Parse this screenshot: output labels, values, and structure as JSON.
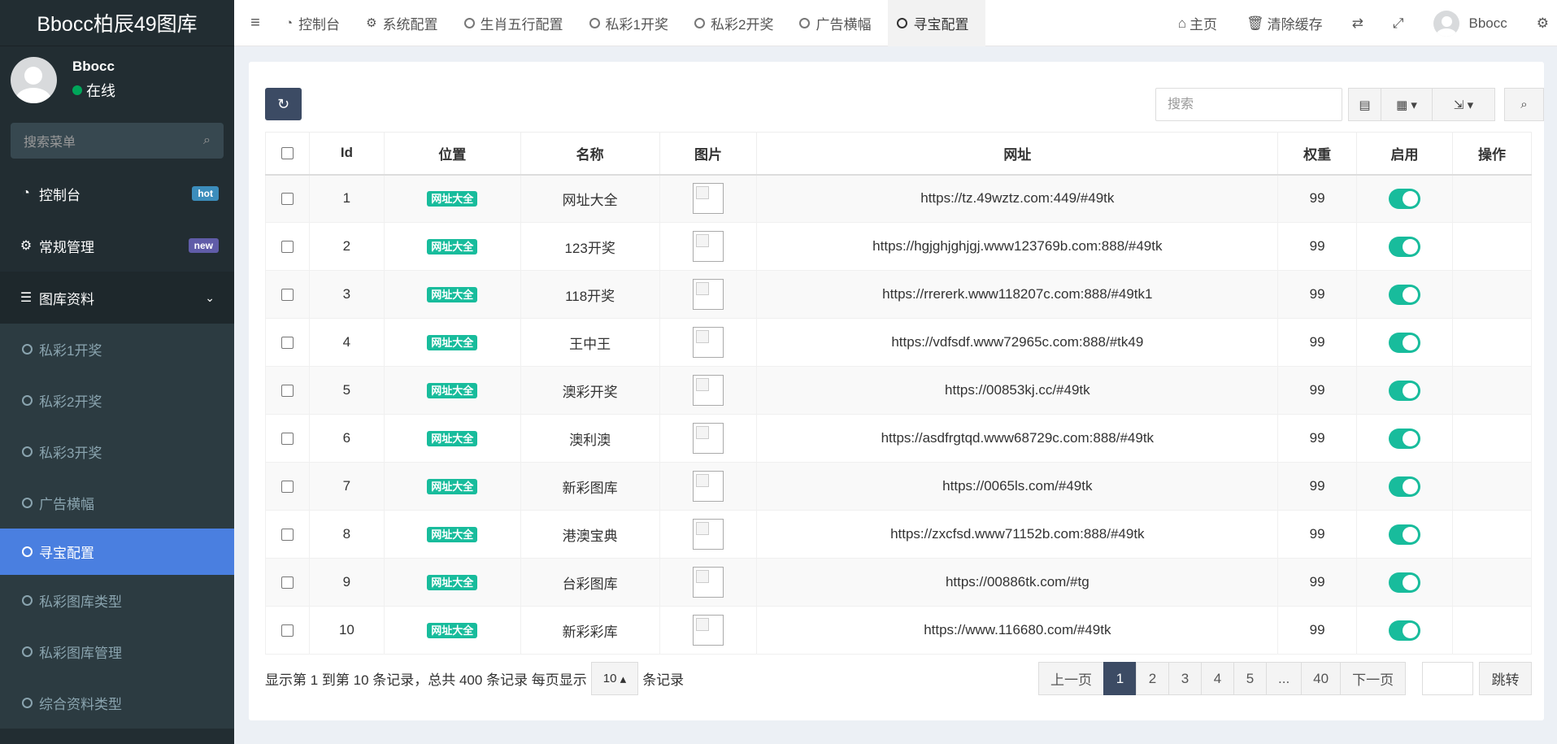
{
  "app": {
    "brand": "Bbocc柏辰49图库"
  },
  "user": {
    "name": "Bbocc",
    "status": "在线"
  },
  "sidebar": {
    "search_placeholder": "搜索菜单",
    "items": [
      {
        "label": "控制台",
        "icon": "dashboard-icon",
        "badge": "hot",
        "badge_color": "#3c8dbc"
      },
      {
        "label": "常规管理",
        "icon": "cogs-icon",
        "badge": "new",
        "badge_color": "#605ca8"
      },
      {
        "label": "图库资料",
        "icon": "list-icon"
      }
    ],
    "sub_items": [
      "私彩1开奖",
      "私彩2开奖",
      "私彩3开奖",
      "广告横幅",
      "寻宝配置",
      "私彩图库类型",
      "私彩图库管理",
      "综合资料类型"
    ],
    "active_sub": "寻宝配置"
  },
  "topbar": {
    "tabs": [
      {
        "label": "控制台",
        "icon": "dashboard-icon"
      },
      {
        "label": "系统配置",
        "icon": "gear-icon"
      },
      {
        "label": "生肖五行配置",
        "icon": "circle-icon"
      },
      {
        "label": "私彩1开奖",
        "icon": "circle-icon"
      },
      {
        "label": "私彩2开奖",
        "icon": "circle-icon"
      },
      {
        "label": "广告横幅",
        "icon": "circle-icon"
      },
      {
        "label": "寻宝配置",
        "icon": "circle-icon",
        "active": true
      }
    ],
    "home_label": "主页",
    "clear_cache_label": "清除缓存",
    "user_name": "Bbocc"
  },
  "toolbar": {
    "search_placeholder": "搜索"
  },
  "table": {
    "columns": [
      "Id",
      "位置",
      "名称",
      "图片",
      "网址",
      "权重",
      "启用",
      "操作"
    ],
    "rows": [
      {
        "id": "1",
        "position": "网址大全",
        "name": "网址大全",
        "url": "https://tz.49wztz.com:449/#49tk",
        "weight": "99",
        "enabled": true
      },
      {
        "id": "2",
        "position": "网址大全",
        "name": "123开奖",
        "url": "https://hgjghjghjgj.www123769b.com:888/#49tk",
        "weight": "99",
        "enabled": true
      },
      {
        "id": "3",
        "position": "网址大全",
        "name": "118开奖",
        "url": "https://rrererk.www118207c.com:888/#49tk1",
        "weight": "99",
        "enabled": true
      },
      {
        "id": "4",
        "position": "网址大全",
        "name": "王中王",
        "url": "https://vdfsdf.www72965c.com:888/#tk49",
        "weight": "99",
        "enabled": true
      },
      {
        "id": "5",
        "position": "网址大全",
        "name": "澳彩开奖",
        "url": "https://00853kj.cc/#49tk",
        "weight": "99",
        "enabled": true
      },
      {
        "id": "6",
        "position": "网址大全",
        "name": "澳利澳",
        "url": "https://asdfrgtqd.www68729c.com:888/#49tk",
        "weight": "99",
        "enabled": true
      },
      {
        "id": "7",
        "position": "网址大全",
        "name": "新彩图库",
        "url": "https://0065ls.com/#49tk",
        "weight": "99",
        "enabled": true
      },
      {
        "id": "8",
        "position": "网址大全",
        "name": "港澳宝典",
        "url": "https://zxcfsd.www71152b.com:888/#49tk",
        "weight": "99",
        "enabled": true
      },
      {
        "id": "9",
        "position": "网址大全",
        "name": "台彩图库",
        "url": "https://00886tk.com/#tg",
        "weight": "99",
        "enabled": true
      },
      {
        "id": "10",
        "position": "网址大全",
        "name": "新彩彩库",
        "url": "https://www.116680.com/#49tk",
        "weight": "99",
        "enabled": true
      }
    ]
  },
  "footer": {
    "info_prefix": "显示第 1 到第 10 条记录，总共 400 条记录 每页显示",
    "page_size": "10",
    "info_suffix": "条记录",
    "prev_label": "上一页",
    "next_label": "下一页",
    "pages": [
      "1",
      "2",
      "3",
      "4",
      "5",
      "...",
      "40"
    ],
    "current_page": "1",
    "jump_label": "跳转"
  },
  "colors": {
    "accent": "#4a7fe0",
    "success": "#18bc9c",
    "sidebar_bg": "#222d32",
    "primary_btn": "#3c4b64"
  }
}
